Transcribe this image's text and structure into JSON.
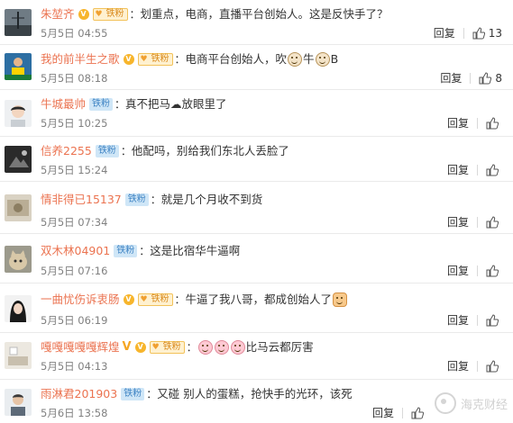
{
  "comments": [
    {
      "user": "朱堃齐",
      "badges": [
        "vip",
        "fan"
      ],
      "fan_label": "铁粉",
      "text": "划重点，电商，直播平台创始人。这是反快手了？",
      "emojis": [],
      "date": "5月5日 04:55",
      "reply": "回复",
      "likes": "13",
      "avatar_icon": "landscape-avatar-icon"
    },
    {
      "user": "我的前半生之歌",
      "badges": [
        "vip",
        "fan"
      ],
      "fan_label": "铁粉",
      "text": "电商平台创始人，吹",
      "text_after": "B",
      "emojis": [
        "cow",
        "cow"
      ],
      "date": "5月5日 08:18",
      "reply": "回复",
      "likes": "8",
      "avatar_icon": "person-avatar-icon"
    },
    {
      "user": "牛城最帅",
      "badges": [
        "tie"
      ],
      "fan_label": "铁粉",
      "text": "真不把马☁放眼里了",
      "emojis": [],
      "date": "5月5日 10:25",
      "reply": "回复",
      "likes": "",
      "avatar_icon": "child-avatar-icon"
    },
    {
      "user": "信养2255",
      "badges": [
        "tie"
      ],
      "fan_label": "铁粉",
      "text": "他配吗，别给我们东北人丢脸了",
      "emojis": [],
      "date": "5月5日 15:24",
      "reply": "回复",
      "likes": "",
      "avatar_icon": "dark-avatar-icon"
    },
    {
      "user": "情非得已15137",
      "badges": [
        "tie"
      ],
      "fan_label": "铁粉",
      "text": "就是几个月收不到货",
      "emojis": [],
      "date": "5月5日 07:34",
      "reply": "回复",
      "likes": "",
      "avatar_icon": "photo-avatar-icon"
    },
    {
      "user": "双木林04901",
      "badges": [
        "tie"
      ],
      "fan_label": "铁粉",
      "text": "这是比宿华牛逼啊",
      "emojis": [],
      "date": "5月5日 07:16",
      "reply": "回复",
      "likes": "",
      "avatar_icon": "cat-avatar-icon"
    },
    {
      "user": "一曲忧伤诉衷肠",
      "badges": [
        "vip",
        "fan"
      ],
      "fan_label": "铁粉",
      "text": "牛逼了我八哥，都成创始人了",
      "emojis": [
        "fist"
      ],
      "date": "5月5日 06:19",
      "reply": "回复",
      "likes": "",
      "avatar_icon": "girl-avatar-icon"
    },
    {
      "user": "嘎嘎嘎嘎嘎辉煌",
      "badges": [
        "v",
        "vip",
        "fan"
      ],
      "fan_label": "铁粉",
      "text": "比马云都厉害",
      "emojis_before": [
        "pig",
        "pig",
        "pig"
      ],
      "emojis": [],
      "date": "5月5日 04:13",
      "reply": "回复",
      "likes": "",
      "avatar_icon": "room-avatar-icon"
    },
    {
      "user": "雨淋君201903",
      "badges": [
        "tie"
      ],
      "fan_label": "铁粉",
      "text": "又碰 别人的蛋糕，抢快手的光环，该死",
      "emojis": [],
      "date": "5月6日 13:58",
      "reply": "回复",
      "likes": "",
      "avatar_icon": "man-avatar-icon"
    }
  ],
  "watermark": "海克财经",
  "colors": {
    "username": "#eb7350",
    "meta": "#808080",
    "badge_tie_bg": "#cfe6f7",
    "badge_fan_bg": "#fff1d0"
  }
}
